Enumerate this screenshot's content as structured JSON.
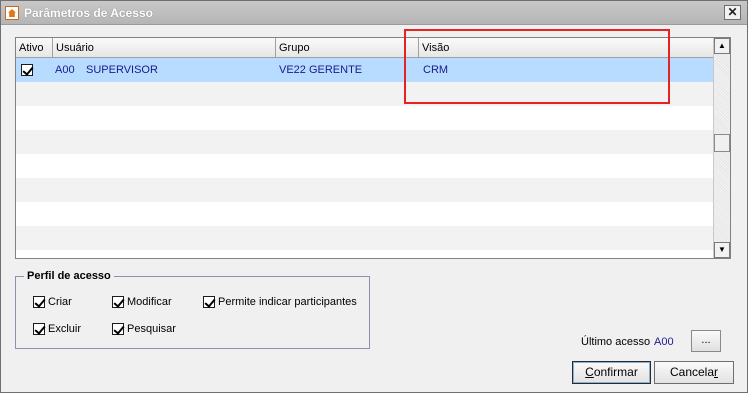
{
  "window": {
    "title": "Parâmetros de Acesso",
    "close_glyph": "✕",
    "icon": "app-house-icon"
  },
  "grid": {
    "columns": [
      "Ativo",
      "Usuário",
      "Grupo",
      "Visão"
    ],
    "rows": [
      {
        "ativo": true,
        "usuario_code": "A00",
        "usuario_name": "SUPERVISOR",
        "grupo": "VE22 GERENTE",
        "visao": "CRM"
      }
    ],
    "scroll_up_glyph": "▲",
    "scroll_down_glyph": "▼"
  },
  "perfil": {
    "title": "Perfil de acesso",
    "options": [
      {
        "label": "Criar",
        "checked": true
      },
      {
        "label": "Modificar",
        "checked": true
      },
      {
        "label": "Permite indicar participantes",
        "checked": true
      },
      {
        "label": "Excluir",
        "checked": true
      },
      {
        "label": "Pesquisar",
        "checked": true
      }
    ]
  },
  "ultimo_acesso": {
    "label": "Último acesso",
    "value": "A00",
    "button_label": "..."
  },
  "buttons": {
    "confirmar_underlined": "C",
    "confirmar_rest": "onfirmar",
    "cancelar_rest": "Cancela",
    "cancelar_underlined": "r"
  },
  "colors": {
    "selected_row": "#b8dcff",
    "value_text": "#1a1a8c",
    "highlight_border": "#e52323"
  }
}
